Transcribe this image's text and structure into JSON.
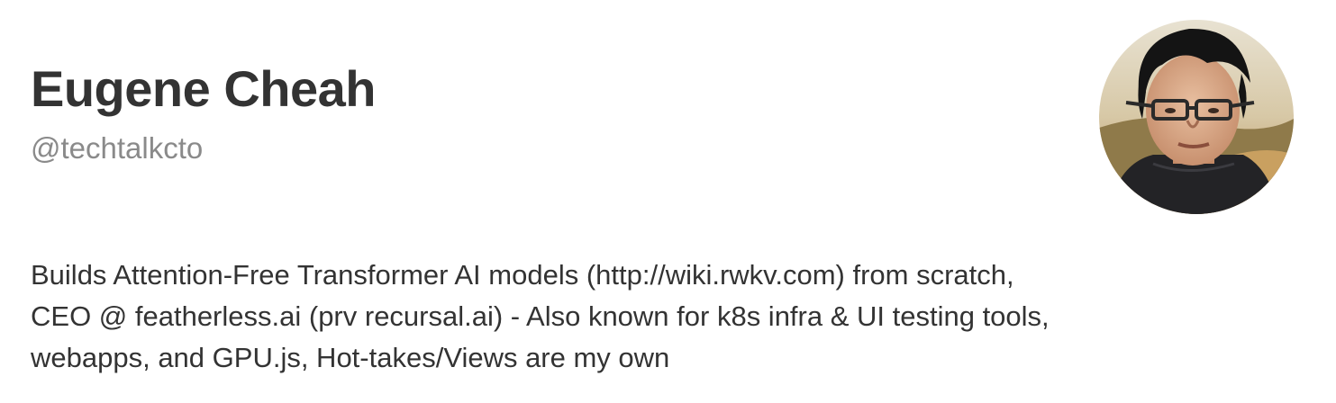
{
  "profile": {
    "name": "Eugene Cheah",
    "handle": "@techtalkcto",
    "bio_lines": [
      "Builds Attention-Free Transformer AI models (http://wiki.rwkv.com) from scratch,",
      "CEO @ featherless.ai (prv recursal.ai) - Also known for k8s infra & UI testing tools,",
      "webapps, and GPU.js, Hot-takes/Views are my own"
    ],
    "avatar_icon": "profile-photo"
  }
}
